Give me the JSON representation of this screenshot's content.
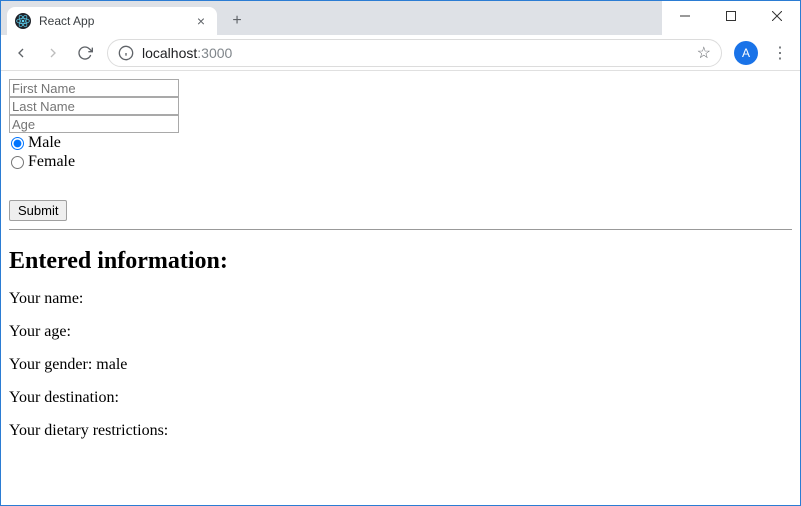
{
  "window": {
    "tab_title": "React App",
    "url_host": "localhost",
    "url_port": ":3000",
    "avatar_initial": "A"
  },
  "form": {
    "first_name_placeholder": "First Name",
    "first_name_value": "",
    "last_name_placeholder": "Last Name",
    "last_name_value": "",
    "age_placeholder": "Age",
    "age_value": "",
    "gender_options": {
      "male": {
        "label": "Male",
        "checked": true
      },
      "female": {
        "label": "Female",
        "checked": false
      }
    },
    "submit_label": "Submit"
  },
  "output": {
    "heading": "Entered information:",
    "name_label": "Your name:",
    "name_value": "",
    "age_label": "Your age:",
    "age_value": "",
    "gender_label": "Your gender: ",
    "gender_value": "male",
    "destination_label": "Your destination:",
    "destination_value": "",
    "dietary_label": "Your dietary restrictions:",
    "dietary_value": ""
  }
}
